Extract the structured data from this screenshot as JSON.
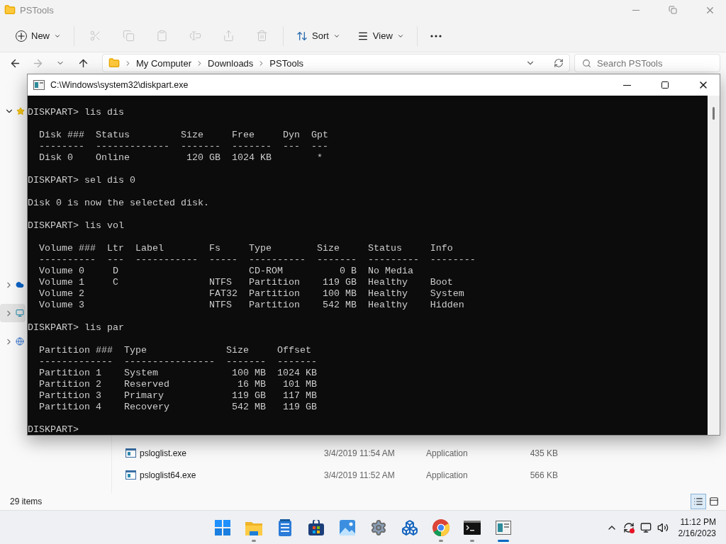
{
  "explorer": {
    "title": "PSTools",
    "toolbar": {
      "new_label": "New",
      "actions": [
        {
          "kind": "cut",
          "disabled": true
        },
        {
          "kind": "copy",
          "disabled": true
        },
        {
          "kind": "paste",
          "disabled": true
        },
        {
          "kind": "rename",
          "disabled": true
        },
        {
          "kind": "share",
          "disabled": true
        },
        {
          "kind": "delete",
          "disabled": true
        }
      ],
      "sort_label": "Sort",
      "view_label": "View"
    },
    "history": [
      {
        "kind": "back",
        "disabled": false
      },
      {
        "kind": "forward",
        "disabled": true
      },
      {
        "kind": "recent",
        "disabled": false
      },
      {
        "kind": "up",
        "disabled": false
      }
    ],
    "address": {
      "crumbs": [
        "My Computer",
        "Downloads",
        "PSTools"
      ],
      "search_placeholder": "Search PSTools"
    },
    "nav": [
      {
        "kind": "quick-access",
        "expanded": true,
        "selected": false
      },
      {
        "kind": "onedrive",
        "expanded": false,
        "selected": false
      },
      {
        "kind": "this-pc",
        "expanded": false,
        "selected": true
      },
      {
        "kind": "network",
        "expanded": false,
        "selected": false
      }
    ],
    "files": [
      {
        "name": "psloglist.exe",
        "modified": "3/4/2019 11:54 AM",
        "type": "Application",
        "size": "435 KB"
      },
      {
        "name": "psloglist64.exe",
        "modified": "3/4/2019 11:52 AM",
        "type": "Application",
        "size": "566 KB"
      }
    ],
    "status": {
      "count": "29 items",
      "views": [
        {
          "kind": "details",
          "selected": true
        },
        {
          "kind": "tiles",
          "selected": false
        }
      ]
    }
  },
  "console": {
    "title": "C:\\Windows\\system32\\diskpart.exe",
    "blocks": [
      [
        "DISKPART> lis dis"
      ],
      [
        "  Disk ###  Status         Size     Free     Dyn  Gpt",
        "  --------  -------------  -------  -------  ---  ---",
        "  Disk 0    Online          120 GB  1024 KB        *"
      ],
      [
        "DISKPART> sel dis 0"
      ],
      [
        "Disk 0 is now the selected disk."
      ],
      [
        "DISKPART> lis vol"
      ],
      [
        "  Volume ###  Ltr  Label        Fs     Type        Size     Status     Info",
        "  ----------  ---  -----------  -----  ----------  -------  ---------  --------",
        "  Volume 0     D                       CD-ROM          0 B  No Media",
        "  Volume 1     C                NTFS   Partition    119 GB  Healthy    Boot",
        "  Volume 2                      FAT32  Partition    100 MB  Healthy    System",
        "  Volume 3                      NTFS   Partition    542 MB  Healthy    Hidden"
      ],
      [
        "DISKPART> lis par"
      ],
      [
        "  Partition ###  Type              Size     Offset",
        "  -------------  ----------------  -------  -------",
        "  Partition 1    System             100 MB  1024 KB",
        "  Partition 2    Reserved            16 MB   101 MB",
        "  Partition 3    Primary            119 GB   117 MB",
        "  Partition 4    Recovery           542 MB   119 GB"
      ],
      [
        "DISKPART>"
      ]
    ]
  },
  "taskbar": {
    "apps": [
      {
        "kind": "start",
        "running": false,
        "active": false
      },
      {
        "kind": "explorer",
        "running": true,
        "active": false
      },
      {
        "kind": "notepad",
        "running": false,
        "active": false
      },
      {
        "kind": "store",
        "running": false,
        "active": false
      },
      {
        "kind": "photos",
        "running": false,
        "active": false
      },
      {
        "kind": "settings",
        "running": false,
        "active": false
      },
      {
        "kind": "boxes",
        "running": false,
        "active": false
      },
      {
        "kind": "browser",
        "running": true,
        "active": false
      },
      {
        "kind": "terminal",
        "running": true,
        "active": false
      },
      {
        "kind": "diskpart",
        "running": true,
        "active": true
      }
    ],
    "clock": {
      "time": "11:12 PM",
      "date": "2/16/2023"
    }
  }
}
